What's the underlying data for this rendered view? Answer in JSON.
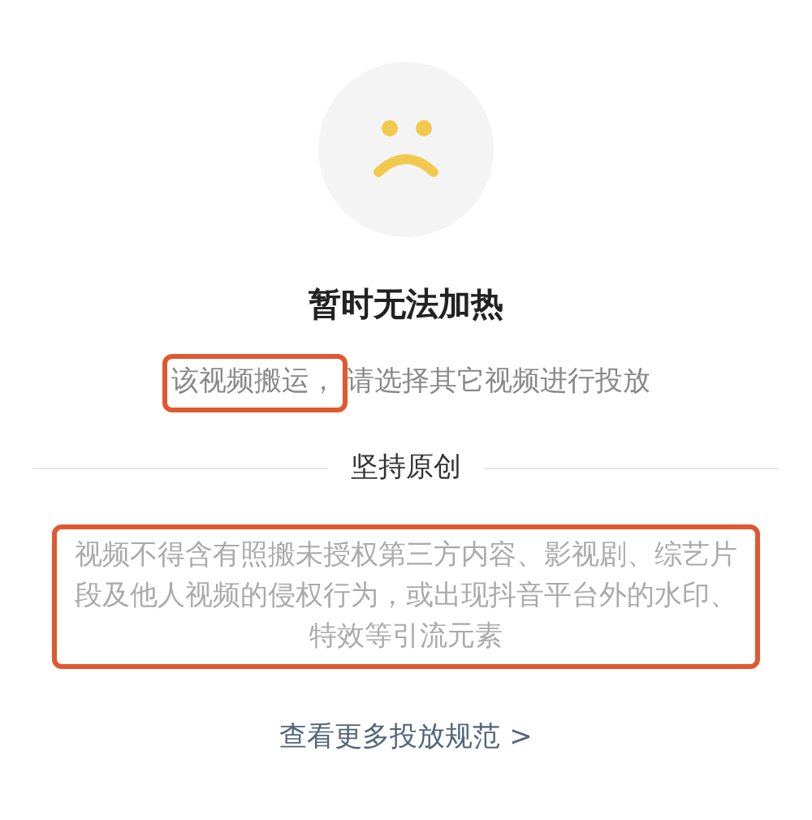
{
  "title": "暂时无法加热",
  "message": [
    {
      "text": "该视频搬运，",
      "highlighted": true
    },
    {
      "text": "请选择其它视频进行投放",
      "highlighted": false
    }
  ],
  "section": {
    "heading": "坚持原创",
    "text": "视频不得含有照搬未授权第三方内容、影视剧、综艺片段及他人视频的侵权行为，或出现抖音平台外的水印、特效等引流元素",
    "highlighted": true
  },
  "link": "查看更多投放规范 >"
}
